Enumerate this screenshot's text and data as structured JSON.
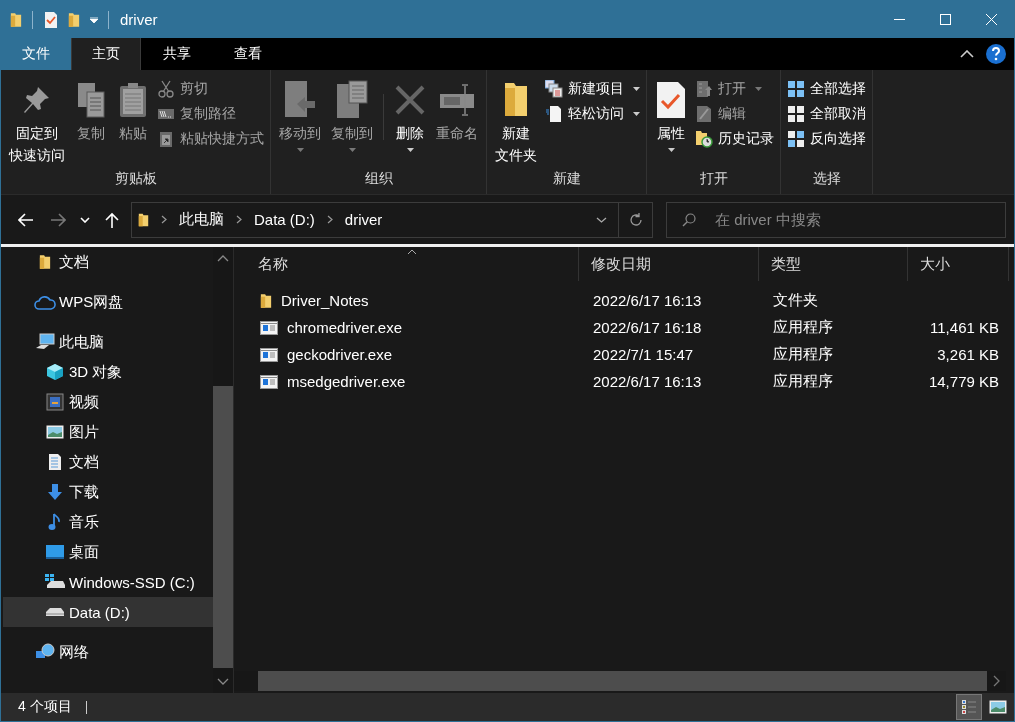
{
  "window": {
    "title": "driver"
  },
  "ribbon_tabs": [
    {
      "label": "文件",
      "kind": "menu",
      "selected": false
    },
    {
      "label": "主页",
      "kind": "tab",
      "selected": true
    },
    {
      "label": "共享",
      "kind": "tab",
      "selected": false
    },
    {
      "label": "查看",
      "kind": "tab",
      "selected": false
    }
  ],
  "ribbon": {
    "groups": [
      {
        "label": "剪贴板",
        "items": [
          {
            "kind": "large",
            "label_lines": [
              "固定到",
              "快速访问"
            ],
            "disabled": false,
            "dropdown": false
          },
          {
            "kind": "large",
            "label": "复制",
            "disabled": true,
            "dropdown": false
          },
          {
            "kind": "large",
            "label": "粘贴",
            "disabled": true,
            "dropdown": false
          },
          {
            "kind": "stack",
            "items": [
              {
                "label": "剪切",
                "disabled": true,
                "dropdown": false
              },
              {
                "label": "复制路径",
                "disabled": true,
                "dropdown": false
              },
              {
                "label": "粘贴快捷方式",
                "disabled": true,
                "dropdown": false
              }
            ]
          }
        ]
      },
      {
        "label": "组织",
        "items": [
          {
            "kind": "large",
            "label": "移动到",
            "disabled": true,
            "dropdown": true
          },
          {
            "kind": "large",
            "label": "复制到",
            "disabled": true,
            "dropdown": true
          },
          {
            "kind": "large",
            "label": "删除",
            "disabled": false,
            "dropdown": true
          },
          {
            "kind": "large",
            "label": "重命名",
            "disabled": true,
            "dropdown": false
          }
        ]
      },
      {
        "label": "新建",
        "items": [
          {
            "kind": "large",
            "label_lines": [
              "新建",
              "文件夹"
            ],
            "disabled": false,
            "dropdown": false
          },
          {
            "kind": "stack",
            "items": [
              {
                "label": "新建项目",
                "disabled": false,
                "dropdown": true
              },
              {
                "label": "轻松访问",
                "disabled": false,
                "dropdown": true
              }
            ]
          }
        ]
      },
      {
        "label": "打开",
        "items": [
          {
            "kind": "large",
            "label": "属性",
            "disabled": false,
            "dropdown": true
          },
          {
            "kind": "stack",
            "items": [
              {
                "label": "打开",
                "disabled": true,
                "dropdown": true
              },
              {
                "label": "编辑",
                "disabled": true,
                "dropdown": false
              },
              {
                "label": "历史记录",
                "disabled": false,
                "dropdown": false
              }
            ]
          }
        ]
      },
      {
        "label": "选择",
        "items": [
          {
            "kind": "stack",
            "items": [
              {
                "label": "全部选择",
                "disabled": false,
                "dropdown": false
              },
              {
                "label": "全部取消",
                "disabled": false,
                "dropdown": false
              },
              {
                "label": "反向选择",
                "disabled": false,
                "dropdown": false
              }
            ]
          }
        ]
      }
    ]
  },
  "nav_buttons": [
    {
      "disabled": false
    },
    {
      "disabled": true
    },
    {
      "disabled": false
    },
    {
      "disabled": false
    }
  ],
  "address": {
    "breadcrumbs": [
      "此电脑",
      "Data (D:)",
      "driver"
    ]
  },
  "search": {
    "placeholder": "在 driver 中搜索"
  },
  "sidebar": {
    "items": [
      {
        "label": "文档",
        "selected": false
      },
      {
        "label": "WPS网盘",
        "selected": false
      },
      {
        "label": "此电脑",
        "selected": false,
        "children": [
          {
            "label": "3D 对象",
            "selected": false
          },
          {
            "label": "视频",
            "selected": false
          },
          {
            "label": "图片",
            "selected": false
          },
          {
            "label": "文档",
            "selected": false
          },
          {
            "label": "下载",
            "selected": false
          },
          {
            "label": "音乐",
            "selected": false
          },
          {
            "label": "桌面",
            "selected": false
          },
          {
            "label": "Windows-SSD (C:)",
            "selected": false
          },
          {
            "label": "Data (D:)",
            "selected": true
          }
        ]
      },
      {
        "label": "网络",
        "selected": false
      }
    ]
  },
  "file_list": {
    "columns": [
      {
        "label": "名称",
        "sorted": true
      },
      {
        "label": "修改日期",
        "sorted": false
      },
      {
        "label": "类型",
        "sorted": false
      },
      {
        "label": "大小",
        "sorted": false
      }
    ],
    "rows": [
      {
        "kind": "folder",
        "name": "Driver_Notes",
        "date": "2022/6/17 16:13",
        "type": "文件夹"
      },
      {
        "kind": "exe",
        "name": "chromedriver.exe",
        "date": "2022/6/17 16:18",
        "type": "应用程序",
        "size": "11,461 KB"
      },
      {
        "kind": "exe",
        "name": "geckodriver.exe",
        "date": "2022/7/1 15:47",
        "type": "应用程序",
        "size": "3,261 KB"
      },
      {
        "kind": "exe",
        "name": "msedgedriver.exe",
        "date": "2022/6/17 16:13",
        "type": "应用程序",
        "size": "14,779 KB"
      }
    ]
  },
  "status_bar": {
    "item_count": "4 个项目",
    "views": [
      {
        "selected": true
      },
      {
        "selected": false
      }
    ]
  }
}
